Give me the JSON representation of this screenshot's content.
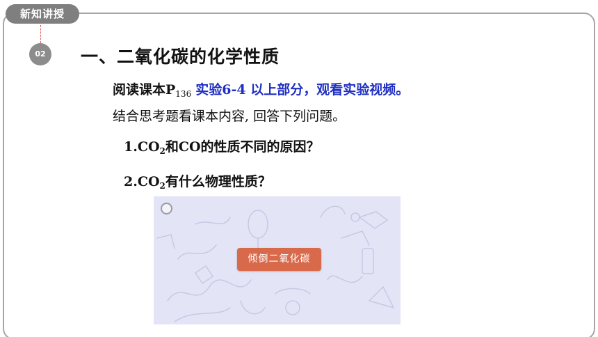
{
  "header": {
    "tag_label": "新知讲授",
    "section_number": "02"
  },
  "main": {
    "heading": "一、二氧化碳的化学性质",
    "line1": {
      "prefix": "阅读课本P",
      "page_sub": "136",
      "highlight": "实验6-4 以上部分，观看实验视频。"
    },
    "line2": "结合思考题看课本内容, 回答下列问题。",
    "question1": {
      "pre": "1.CO",
      "sub": "2",
      "post": "和CO的性质不同的原因？"
    },
    "question2": {
      "pre": "2.CO",
      "sub": "2",
      "post": "有什么物理性质？"
    }
  },
  "video": {
    "button_label": "倾倒二氧化碳"
  },
  "colors": {
    "accent_blue": "#1f2fc4",
    "button": "#d9694b",
    "tag_bg": "#7f7f7f"
  }
}
